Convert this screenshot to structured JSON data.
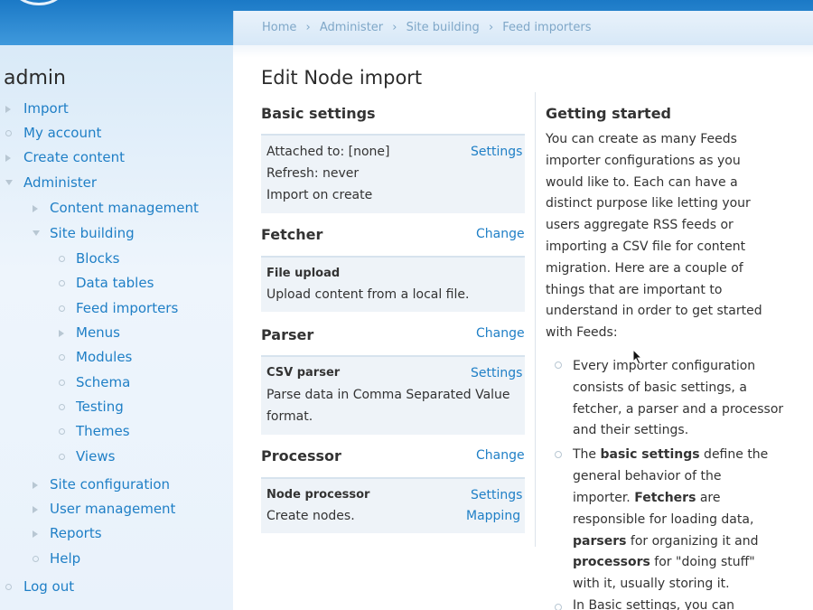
{
  "breadcrumb": [
    "Home",
    "Administer",
    "Site building",
    "Feed importers"
  ],
  "breadcrumb_sep": "›",
  "sidebar": {
    "title": "admin",
    "items": [
      {
        "label": "Import",
        "bullet": "right",
        "indent": 0
      },
      {
        "label": "My account",
        "bullet": "circle",
        "indent": 0
      },
      {
        "label": "Create content",
        "bullet": "right",
        "indent": 0
      },
      {
        "label": "Administer",
        "bullet": "down",
        "indent": 0
      },
      {
        "label": "Content management",
        "bullet": "right",
        "indent": 1
      },
      {
        "label": "Site building",
        "bullet": "down",
        "indent": 1
      },
      {
        "label": "Blocks",
        "bullet": "circle",
        "indent": 2
      },
      {
        "label": "Data tables",
        "bullet": "circle",
        "indent": 2
      },
      {
        "label": "Feed importers",
        "bullet": "circle",
        "indent": 2
      },
      {
        "label": "Menus",
        "bullet": "right",
        "indent": 2
      },
      {
        "label": "Modules",
        "bullet": "circle",
        "indent": 2
      },
      {
        "label": "Schema",
        "bullet": "circle",
        "indent": 2
      },
      {
        "label": "Testing",
        "bullet": "circle",
        "indent": 2
      },
      {
        "label": "Themes",
        "bullet": "circle",
        "indent": 2
      },
      {
        "label": "Views",
        "bullet": "circle",
        "indent": 2
      },
      {
        "label": "Site configuration",
        "bullet": "right",
        "indent": 1
      },
      {
        "label": "User management",
        "bullet": "right",
        "indent": 1
      },
      {
        "label": "Reports",
        "bullet": "right",
        "indent": 1
      },
      {
        "label": "Help",
        "bullet": "circle",
        "indent": 1
      },
      {
        "label": "Log out",
        "bullet": "circle",
        "indent": 0
      }
    ]
  },
  "page_title": "Edit Node import",
  "basic_settings": {
    "heading": "Basic settings",
    "attached": "Attached to: [none]",
    "refresh": "Refresh: never",
    "import_on_create": "Import on create",
    "settings_link": "Settings"
  },
  "fetcher": {
    "heading": "Fetcher",
    "change_link": "Change",
    "name": "File upload",
    "description": "Upload content from a local file."
  },
  "parser": {
    "heading": "Parser",
    "change_link": "Change",
    "name": "CSV parser",
    "settings_link": "Settings",
    "description_1": "Parse data in Comma Separated Value",
    "description_2": "format."
  },
  "processor": {
    "heading": "Processor",
    "change_link": "Change",
    "name": "Node processor",
    "settings_link": "Settings",
    "description": "Create nodes.",
    "mapping_link": "Mapping"
  },
  "help": {
    "title": "Getting started",
    "intro": [
      "You can create as many Feeds",
      "importer configurations as you",
      "would like to. Each can have a",
      "distinct purpose like letting your",
      "users aggregate RSS feeds or",
      "importing a CSV file for content",
      "migration. Here are a couple of",
      "things that are important to",
      "understand in order to get started",
      "with Feeds:"
    ],
    "li1": [
      "Every importer configuration",
      "consists of basic settings, a",
      "fetcher, a parser and a processor",
      "and their settings."
    ],
    "li2": {
      "l1_a": "The ",
      "l1_b": "basic settings",
      "l1_c": " define the",
      "l2": "general behavior of the",
      "l3_a": "importer. ",
      "l3_b": "Fetchers",
      "l3_c": " are",
      "l4": "responsible for loading data,",
      "l5_a": "parsers",
      "l5_b": " for organizing it and",
      "l6_a": "processors",
      "l6_b": " for \"doing stuff\"",
      "l7": "with it, usually storing it."
    },
    "li3": "In Basic settings, you can"
  }
}
